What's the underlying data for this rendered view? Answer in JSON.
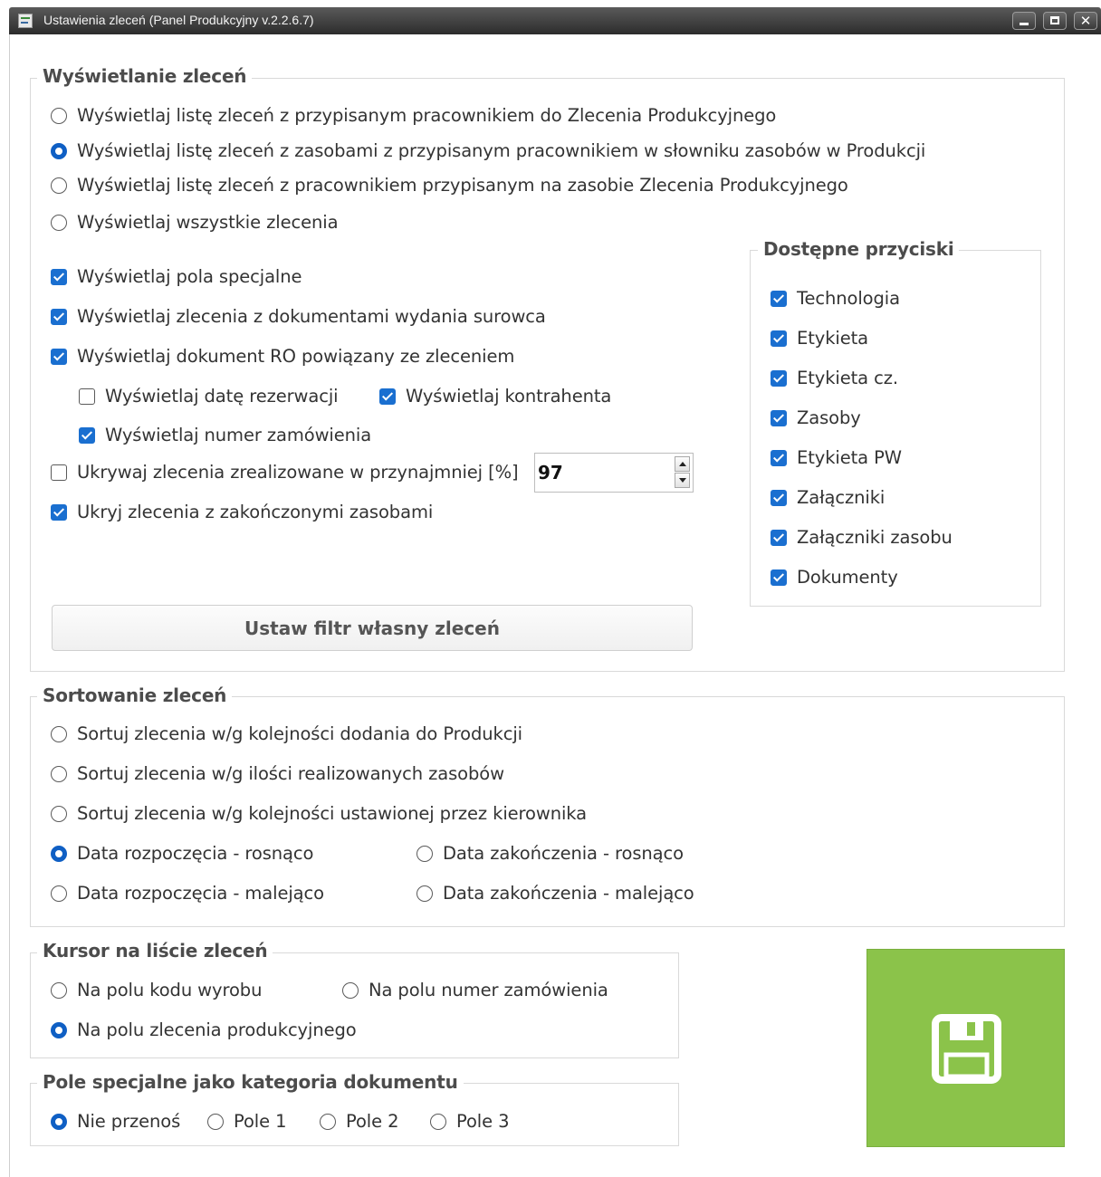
{
  "window": {
    "title": "Ustawienia zleceń (Panel Produkcyjny v.2.2.6.7)"
  },
  "display": {
    "legend": "Wyświetlanie zleceń",
    "radios": [
      {
        "label": "Wyświetlaj listę zleceń z przypisanym pracownikiem do Zlecenia Produkcyjnego",
        "selected": false
      },
      {
        "label": "Wyświetlaj listę zleceń z zasobami z przypisanym pracownikiem w słowniku zasobów w Produkcji",
        "selected": true
      },
      {
        "label": "Wyświetlaj listę zleceń z pracownikiem przypisanym na zasobie Zlecenia Produkcyjnego",
        "selected": false
      },
      {
        "label": "Wyświetlaj wszystkie zlecenia",
        "selected": false
      }
    ],
    "checks": {
      "special_fields": {
        "label": "Wyświetlaj pola specjalne",
        "checked": true
      },
      "raw_docs": {
        "label": "Wyświetlaj zlecenia z dokumentami wydania surowca",
        "checked": true
      },
      "ro_doc": {
        "label": "Wyświetlaj dokument RO powiązany ze zleceniem",
        "checked": true
      },
      "reservation_date": {
        "label": "Wyświetlaj datę rezerwacji",
        "checked": false
      },
      "contractor": {
        "label": "Wyświetlaj kontrahenta",
        "checked": true
      },
      "order_number": {
        "label": "Wyświetlaj numer zamówienia",
        "checked": true
      },
      "hide_realized": {
        "label": "Ukrywaj zlecenia zrealizowane w przynajmniej [%]",
        "checked": false
      },
      "hide_finished": {
        "label": "Ukryj zlecenia z zakończonymi zasobami",
        "checked": true
      }
    },
    "percent_value": "97",
    "filter_button": "Ustaw filtr własny zleceń"
  },
  "buttons_group": {
    "legend": "Dostępne przyciski",
    "items": [
      {
        "label": "Technologia",
        "checked": true
      },
      {
        "label": "Etykieta",
        "checked": true
      },
      {
        "label": "Etykieta cz.",
        "checked": true
      },
      {
        "label": "Zasoby",
        "checked": true
      },
      {
        "label": "Etykieta PW",
        "checked": true
      },
      {
        "label": "Załączniki",
        "checked": true
      },
      {
        "label": "Załączniki zasobu",
        "checked": true
      },
      {
        "label": "Dokumenty",
        "checked": true
      }
    ]
  },
  "sorting": {
    "legend": "Sortowanie zleceń",
    "options": [
      {
        "label": "Sortuj zlecenia w/g kolejności dodania do Produkcji",
        "selected": false
      },
      {
        "label": "Sortuj zlecenia w/g ilości realizowanych zasobów",
        "selected": false
      },
      {
        "label": "Sortuj zlecenia w/g kolejności ustawionej przez kierownika",
        "selected": false
      },
      {
        "label": "Data rozpoczęcia - rosnąco",
        "selected": true
      },
      {
        "label": "Data zakończenia - rosnąco",
        "selected": false
      },
      {
        "label": "Data rozpoczęcia - malejąco",
        "selected": false
      },
      {
        "label": "Data zakończenia - malejąco",
        "selected": false
      }
    ]
  },
  "cursor": {
    "legend": "Kursor na liście zleceń",
    "options": [
      {
        "label": "Na polu kodu wyrobu",
        "selected": false
      },
      {
        "label": "Na polu numer zamówienia",
        "selected": false
      },
      {
        "label": "Na polu zlecenia produkcyjnego",
        "selected": true
      }
    ]
  },
  "special_field": {
    "legend": "Pole specjalne jako kategoria dokumentu",
    "options": [
      {
        "label": "Nie przenoś",
        "selected": true
      },
      {
        "label": "Pole 1",
        "selected": false
      },
      {
        "label": "Pole 2",
        "selected": false
      },
      {
        "label": "Pole 3",
        "selected": false
      }
    ]
  },
  "colors": {
    "accent": "#1a6fd0",
    "save_button": "#8bc34a",
    "titlebar": "#3a3a3a"
  },
  "icons": {
    "save": "floppy-disk-icon",
    "window_minimize": "minimize-icon",
    "window_maximize": "maximize-icon",
    "window_close": "close-icon"
  }
}
